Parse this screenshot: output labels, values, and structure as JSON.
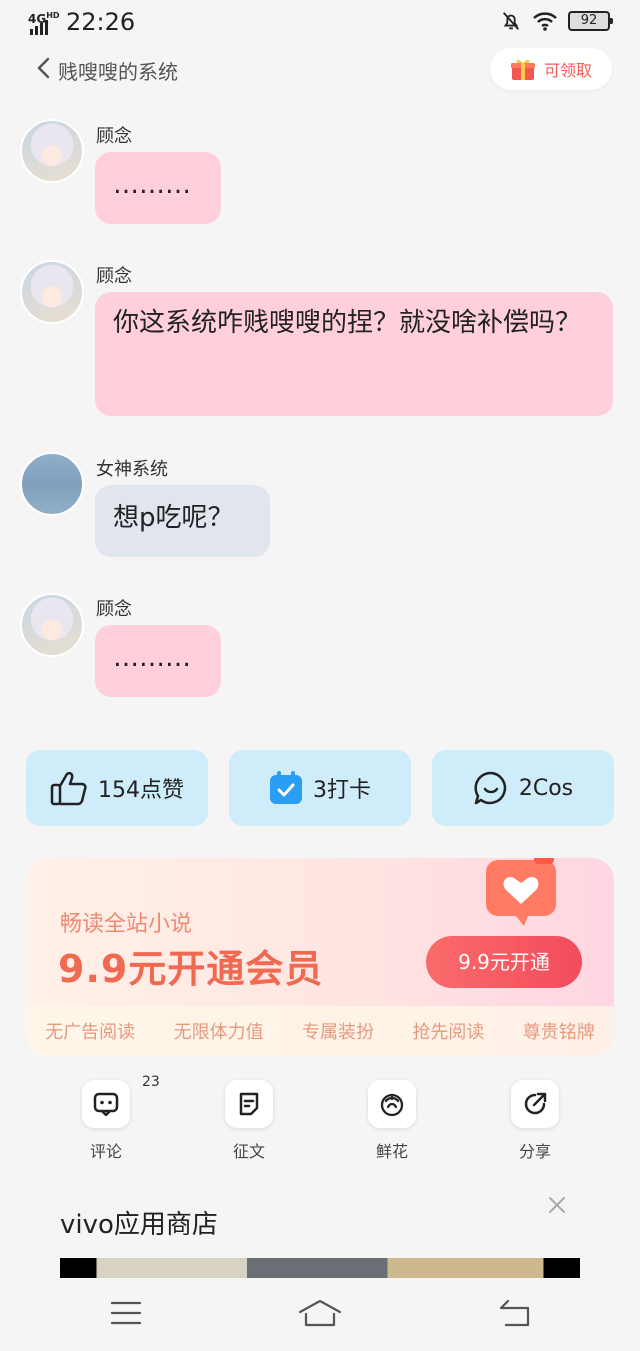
{
  "status_bar": {
    "network": "4G",
    "hd": "HD",
    "time": "22:26",
    "battery": "92"
  },
  "header": {
    "back_label": "贱嗖嗖的系统",
    "claim_label": "可领取"
  },
  "messages": [
    {
      "sender": "顾念",
      "text": "………"
    },
    {
      "sender": "顾念",
      "text": "你这系统咋贱嗖嗖的捏？就没啥补偿吗？"
    },
    {
      "sender": "女神系统",
      "text": "想p吃呢？"
    },
    {
      "sender": "顾念",
      "text": "………"
    }
  ],
  "stats": {
    "likes": "154点赞",
    "checkins": "3打卡",
    "cos": "2Cos"
  },
  "membership": {
    "subtitle": "畅读全站小说",
    "title": "9.9元开通会员",
    "button": "9.9元开通",
    "perks": [
      "无广告阅读",
      "无限体力值",
      "专属装扮",
      "抢先阅读",
      "尊贵铭牌"
    ]
  },
  "actions": {
    "comment": "评论",
    "comment_count": "23",
    "essay": "征文",
    "flower": "鲜花",
    "share": "分享"
  },
  "ad": {
    "title": "vivo应用商店"
  },
  "colors": {
    "bubble_user": "#ffd0dc",
    "bubble_system": "#e1e6ee",
    "stat_bg": "#cfecfa",
    "accent": "#f24c5c"
  }
}
